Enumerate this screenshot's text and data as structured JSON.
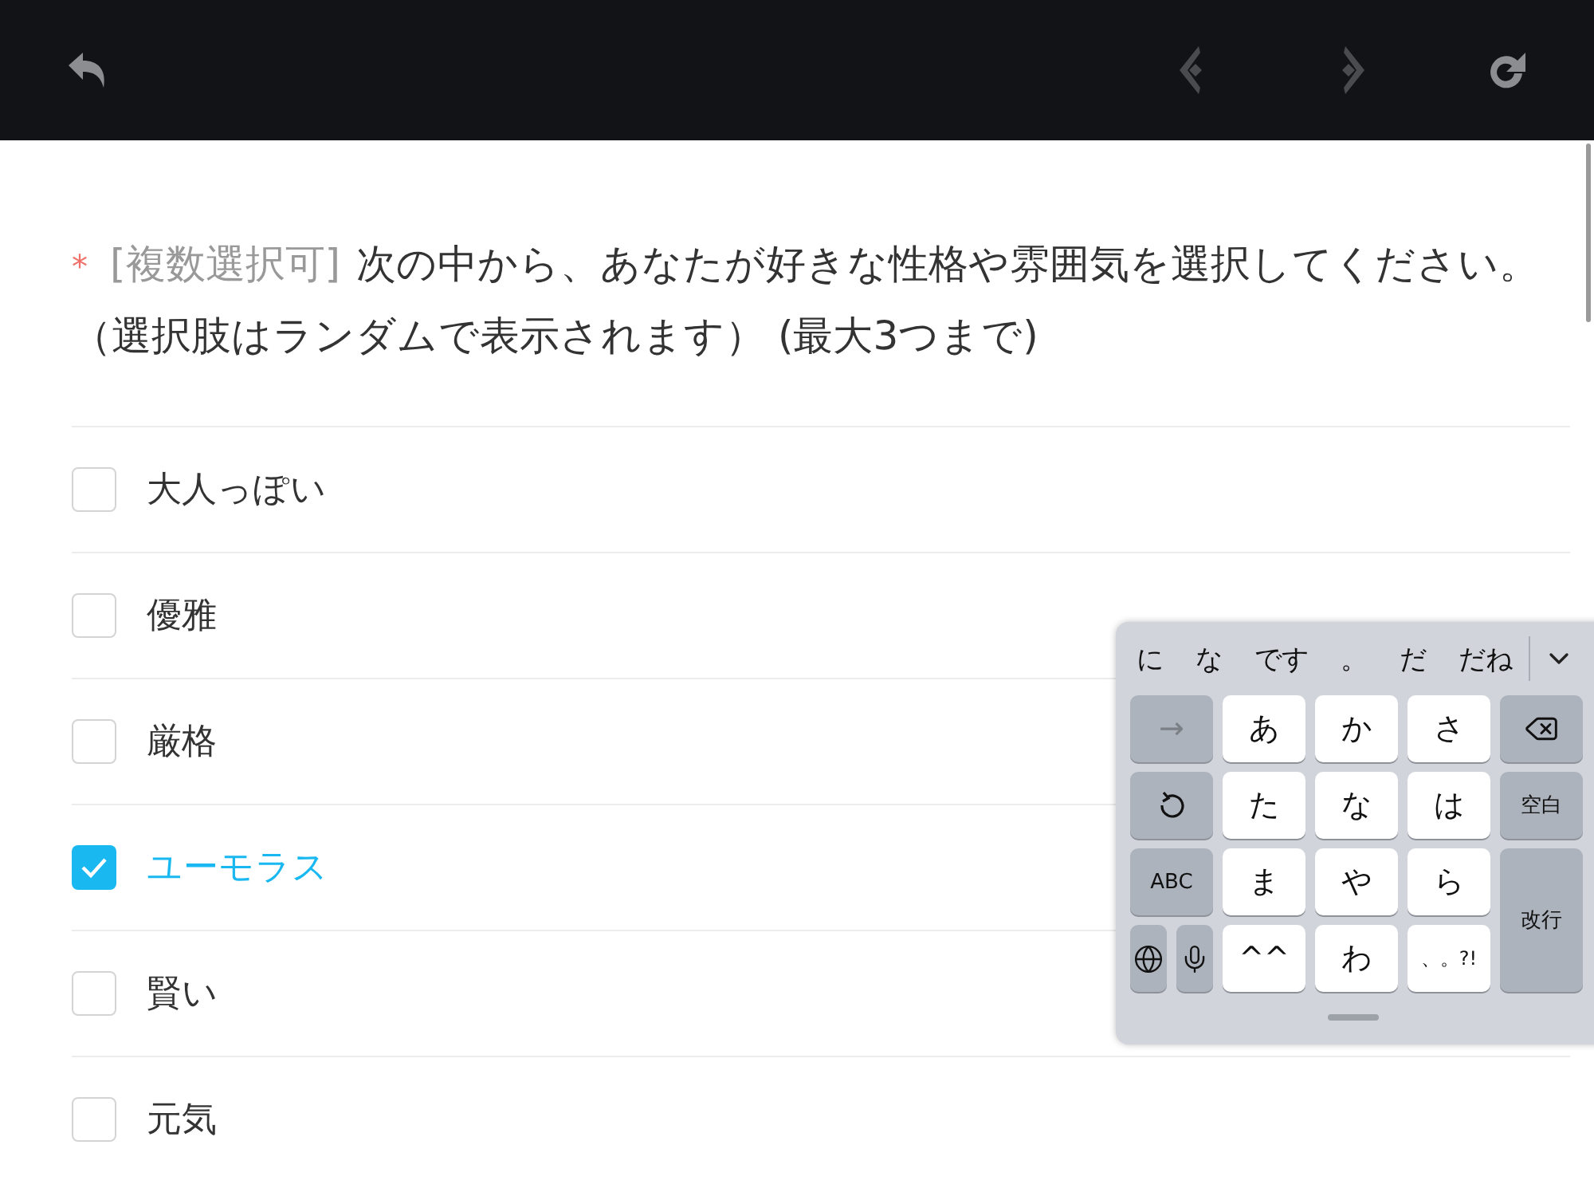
{
  "toolbar": {
    "buttons": [
      {
        "kind": "undo",
        "disabled": false
      },
      {
        "kind": "previous",
        "disabled": true
      },
      {
        "kind": "next",
        "disabled": true
      },
      {
        "kind": "reload",
        "disabled": false
      }
    ]
  },
  "question": {
    "required_mark": "*",
    "tag": "[複数選択可]",
    "text": "次の中から、あなたが好きな性格や雰囲気を選択してください。（選択肢はランダムで表示されます） (最大3つまで)"
  },
  "options": [
    {
      "label": "大人っぽい",
      "checked": false
    },
    {
      "label": "優雅",
      "checked": false
    },
    {
      "label": "厳格",
      "checked": false
    },
    {
      "label": "ユーモラス",
      "checked": true
    },
    {
      "label": "賢い",
      "checked": false
    },
    {
      "label": "元気",
      "checked": false
    }
  ],
  "keyboard": {
    "suggestions": [
      "に",
      "な",
      "です",
      "。",
      "だ",
      "だね"
    ],
    "rows": [
      {
        "left": [
          {
            "kind": "arrow",
            "label": "→"
          }
        ],
        "keys": [
          "あ",
          "か",
          "さ"
        ],
        "right": {
          "kind": "backspace"
        }
      },
      {
        "left": [
          {
            "kind": "undo"
          }
        ],
        "keys": [
          "た",
          "な",
          "は"
        ],
        "right": {
          "kind": "text",
          "label": "空白"
        }
      },
      {
        "left": [
          {
            "kind": "text",
            "label": "ABC"
          }
        ],
        "keys": [
          "ま",
          "や",
          "ら"
        ],
        "right": {
          "kind": "enter",
          "label": "改行"
        }
      },
      {
        "left": [
          {
            "kind": "globe"
          },
          {
            "kind": "mic"
          }
        ],
        "keys": [
          "^^",
          "わ",
          "、。?!"
        ]
      }
    ]
  }
}
